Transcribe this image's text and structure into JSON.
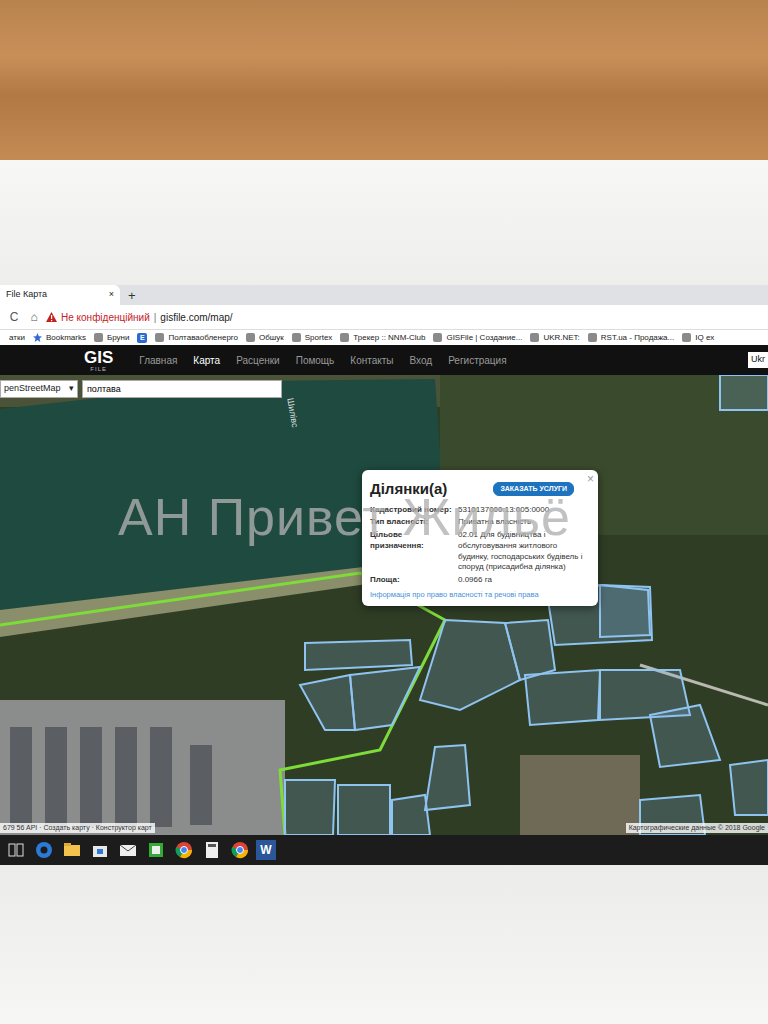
{
  "browser": {
    "tab": {
      "title": "File Карта",
      "close": "×"
    },
    "new_tab": "+",
    "address": {
      "glyphs": [
        "C",
        "⌂"
      ],
      "security": "Не конфіденційний",
      "separator": "|",
      "url": "gisfile.com/map/"
    },
    "bookmarks": [
      {
        "label": "атки",
        "kind": "folder"
      },
      {
        "label": "Bookmarks",
        "kind": "star"
      },
      {
        "label": "Бруни",
        "kind": "site"
      },
      {
        "label": "E",
        "kind": "letter"
      },
      {
        "label": "Полтаваобленерго",
        "kind": "site"
      },
      {
        "label": "Обшук",
        "kind": "site"
      },
      {
        "label": "Sportex",
        "kind": "site"
      },
      {
        "label": "Трекер :: NNM-Club",
        "kind": "site"
      },
      {
        "label": "GISFile | Создание...",
        "kind": "site"
      },
      {
        "label": "UKR.NET:",
        "kind": "site"
      },
      {
        "label": "RST.ua - Продажа...",
        "kind": "site"
      },
      {
        "label": "IQ ex",
        "kind": "site"
      }
    ]
  },
  "site": {
    "logo": "GIS",
    "logo_sub": "FILE",
    "nav": [
      {
        "label": "Главная",
        "selected": false
      },
      {
        "label": "Карта",
        "selected": true
      },
      {
        "label": "Расценки",
        "selected": false
      },
      {
        "label": "Помощь",
        "selected": false
      },
      {
        "label": "Контакты",
        "selected": false
      },
      {
        "label": "Вход",
        "selected": false
      },
      {
        "label": "Регистрация",
        "selected": false
      }
    ],
    "language": "Ukr"
  },
  "map": {
    "layer": "penStreetMap",
    "layer_arrow": "▾",
    "search": "полтава",
    "street_label": "Шилівс",
    "footer_left": "679 56 API · Создать карту · Конструктор карт",
    "footer_right": "Картографические данные © 2018 Google"
  },
  "popup": {
    "title": "Ділянки(а)",
    "button": "ЗАКАЗАТЬ УСЛУГИ",
    "close": "×",
    "fields": [
      {
        "label": "Кадастровий номер:",
        "value": "5310137000:13:005:0000"
      },
      {
        "label": "Тип власності:",
        "value": "Приватна власність"
      },
      {
        "label": "Цільове призначення:",
        "value": "02.01 Для будівництва і обслуговування житлового будинку, господарських будівель і споруд (присадибна ділянка)"
      },
      {
        "label": "Площа:",
        "value": "0.0966 га"
      }
    ],
    "link": "Інформація про право власності та речові права"
  },
  "watermark": "АН Привет Жильё",
  "taskbar": [
    {
      "kind": "window",
      "label": ""
    },
    {
      "kind": "edge",
      "label": ""
    },
    {
      "kind": "folder",
      "label": ""
    },
    {
      "kind": "store",
      "label": ""
    },
    {
      "kind": "mail",
      "label": ""
    },
    {
      "kind": "app",
      "label": ""
    },
    {
      "kind": "chrome",
      "label": ""
    },
    {
      "kind": "calculator",
      "label": ""
    },
    {
      "kind": "chrome",
      "label": ""
    },
    {
      "kind": "word",
      "label": "W"
    }
  ]
}
